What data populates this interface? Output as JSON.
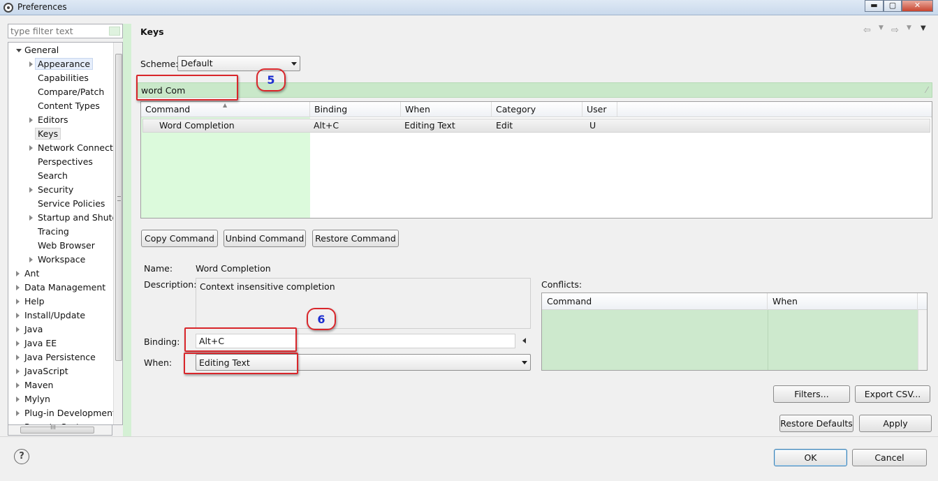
{
  "window": {
    "title": "Preferences",
    "controls": {
      "minimize": "▬",
      "maximize": "▢",
      "close": "✕"
    }
  },
  "filter": {
    "placeholder": "type filter text"
  },
  "tree": {
    "items": [
      {
        "label": "General",
        "level": 0,
        "expanded": true
      },
      {
        "label": "Appearance",
        "level": 1,
        "arrow": true
      },
      {
        "label": "Capabilities",
        "level": 1
      },
      {
        "label": "Compare/Patch",
        "level": 1
      },
      {
        "label": "Content Types",
        "level": 1
      },
      {
        "label": "Editors",
        "level": 1,
        "arrow": true
      },
      {
        "label": "Keys",
        "level": 1
      },
      {
        "label": "Network Connectio",
        "level": 1,
        "arrow": true
      },
      {
        "label": "Perspectives",
        "level": 1
      },
      {
        "label": "Search",
        "level": 1
      },
      {
        "label": "Security",
        "level": 1,
        "arrow": true
      },
      {
        "label": "Service Policies",
        "level": 1
      },
      {
        "label": "Startup and Shutd",
        "level": 1,
        "arrow": true
      },
      {
        "label": "Tracing",
        "level": 1
      },
      {
        "label": "Web Browser",
        "level": 1
      },
      {
        "label": "Workspace",
        "level": 1,
        "arrow": true
      },
      {
        "label": "Ant",
        "level": 0,
        "arrow": true
      },
      {
        "label": "Data Management",
        "level": 0,
        "arrow": true
      },
      {
        "label": "Help",
        "level": 0,
        "arrow": true
      },
      {
        "label": "Install/Update",
        "level": 0,
        "arrow": true
      },
      {
        "label": "Java",
        "level": 0,
        "arrow": true
      },
      {
        "label": "Java EE",
        "level": 0,
        "arrow": true
      },
      {
        "label": "Java Persistence",
        "level": 0,
        "arrow": true
      },
      {
        "label": "JavaScript",
        "level": 0,
        "arrow": true
      },
      {
        "label": "Maven",
        "level": 0,
        "arrow": true
      },
      {
        "label": "Mylyn",
        "level": 0,
        "arrow": true
      },
      {
        "label": "Plug-in Development",
        "level": 0,
        "arrow": true
      },
      {
        "label": "Remote Systems",
        "level": 0,
        "arrow": true
      }
    ],
    "hscroll_grip": "III"
  },
  "page": {
    "title": "Keys",
    "scheme_label": "Scheme:",
    "scheme_value": "Default",
    "search_value": "word Com",
    "table": {
      "headers": [
        "Command",
        "Binding",
        "When",
        "Category",
        "User"
      ],
      "rows": [
        [
          "Word Completion",
          "Alt+C",
          "Editing Text",
          "Edit",
          "U"
        ]
      ]
    },
    "buttons": {
      "copy": "Copy Command",
      "unbind": "Unbind Command",
      "restore": "Restore Command"
    },
    "details": {
      "name_label": "Name:",
      "name_value": "Word Completion",
      "description_label": "Description:",
      "description_value": "Context insensitive completion",
      "binding_label": "Binding:",
      "binding_value": "Alt+C",
      "when_label": "When:",
      "when_value": "Editing Text"
    },
    "conflicts": {
      "label": "Conflicts:",
      "headers": [
        "Command",
        "When"
      ]
    },
    "actions": {
      "filters": "Filters...",
      "export": "Export CSV...",
      "restore_defaults": "Restore Defaults",
      "apply": "Apply"
    },
    "annotations": {
      "badge_search": "5",
      "badge_binding": "6"
    }
  },
  "footer": {
    "help": "?",
    "ok": "OK",
    "cancel": "Cancel"
  },
  "colors": {
    "annotation_red": "#d9262b",
    "badge_text_blue": "#1b2ecf",
    "filter_green": "#c9e8c9"
  }
}
